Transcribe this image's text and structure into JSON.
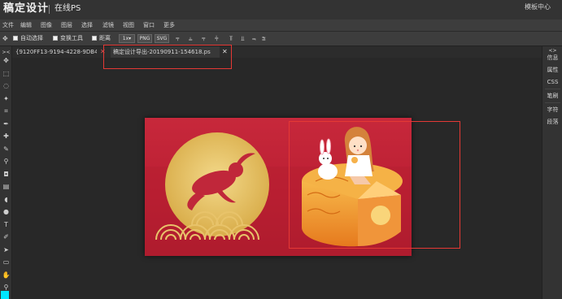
{
  "app": {
    "logo": "稿定设计",
    "subtitle": "在线PS",
    "template_center": "模板中心"
  },
  "menu": [
    "文件",
    "编辑",
    "图像",
    "图层",
    "选择",
    "滤镜",
    "视图",
    "窗口",
    "更多"
  ],
  "options": {
    "auto_select": "自动选择",
    "transform_tools": "变换工具",
    "distance": "距离",
    "zoom_label": "1x",
    "png": "PNG",
    "svg": "SVG"
  },
  "tabs": [
    {
      "label": "{9120FF13-9194-4228-9DB4-",
      "close": "✕",
      "close_color": "#e05050"
    },
    {
      "label": "稿定设计导出-20190911-154618.ps",
      "close": "✕",
      "close_color": "#dddddd"
    }
  ],
  "right_panel": [
    "信息",
    "属性",
    "CSS",
    "笔刷",
    "字符",
    "段落"
  ],
  "toolbox": {
    "icons": [
      "move-icon",
      "marquee-icon",
      "lasso-icon",
      "magic-wand-icon",
      "crop-icon",
      "eyedropper-icon",
      "healing-icon",
      "brush-icon",
      "clone-stamp-icon",
      "eraser-icon",
      "gradient-icon",
      "blur-icon",
      "dodge-icon",
      "type-icon",
      "pen-icon",
      "path-select-icon",
      "shape-icon",
      "hand-icon",
      "zoom-icon"
    ],
    "glyphs": [
      "✥",
      "⬚",
      "◌",
      "✦",
      "⌗",
      "✒",
      "✚",
      "✎",
      "⚲",
      "◘",
      "▤",
      "◖",
      "●",
      "T",
      "✐",
      "➤",
      "▭",
      "✋",
      "⚲"
    ]
  },
  "colors": {
    "accent_red": "#e53935",
    "card_red": "#bb1f33",
    "moon_gold": "#e6c36a",
    "mooncake_orange": "#f29a2a",
    "foreground_swatch": "#00e5ff"
  }
}
